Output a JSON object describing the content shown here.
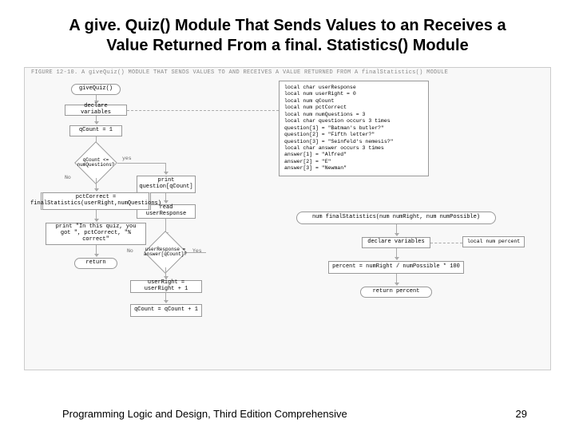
{
  "title": "A give. Quiz() Module That Sends Values to an Receives a Value Returned From a final. Statistics() Module",
  "figure_caption": "FIGURE 12-10. A giveQuiz() MODULE THAT SENDS VALUES TO AND RECEIVES A VALUE RETURNED FROM A finalStatistics() MODULE",
  "left": {
    "start": "giveQuiz()",
    "declare": "declare variables",
    "init": "qCount = 1",
    "cond1": "qCount <= numQuestions?",
    "cond1_no": "No",
    "cond1_yes": "yes",
    "call": "pctCorrect = finalStatistics(userRight,numQuestions)",
    "printResult": "print \"In this quiz, you got \", pctCorrect, \"% correct\"",
    "ret": "return",
    "printQ": "print question[qCount]",
    "read": "read userResponse",
    "cond2": "userResponse = answer[qCount]?",
    "cond2_no": "No",
    "cond2_yes": "Yes",
    "incRight": "userRight = userRight + 1",
    "incCount": "qCount = qCount + 1"
  },
  "decl": {
    "l1": "local char userResponse",
    "l2": "local num userRight = 0",
    "l3": "local num qCount",
    "l4": "local num pctCorrect",
    "l5": "local num numQuestions = 3",
    "l6": "local char question occurs 3 times",
    "l7": "    question[1] = \"Batman's butler?\"",
    "l8": "    question[2] = \"Fifth letter?\"",
    "l9": "    question[3] = \"Seinfeld's nemesis?\"",
    "l10": "local char answer occurs 3 times",
    "l11": "    answer[1] = \"Alfred\"",
    "l12": "    answer[2] = \"E\"",
    "l13": "    answer[3] = \"Newman\""
  },
  "right": {
    "start": "num finalStatistics(num numRight, num numPossible)",
    "declare": "declare variables",
    "declNote": "local num percent",
    "calc": "percent = numRight / numPossible * 100",
    "ret": "return percent"
  },
  "footer_left": "Programming Logic and Design, Third Edition Comprehensive",
  "footer_right": "29"
}
